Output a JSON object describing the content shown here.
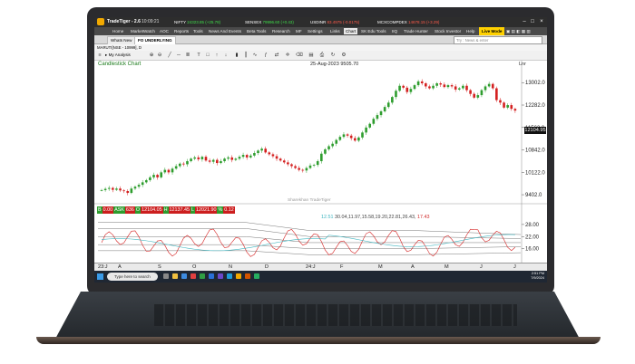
{
  "app": {
    "name": "TradeTiger - 2.6",
    "time": "10:09:21"
  },
  "tickers": [
    {
      "name": "NIFTY",
      "value": "24323.85 (+25.78)",
      "dir": "up"
    },
    {
      "name": "SENSEX",
      "value": "79996.60 (+0.43)",
      "dir": "up"
    },
    {
      "name": "USDINR",
      "value": "83.4975 (-0.0175)",
      "dir": "dn"
    },
    {
      "name": "MCXCOMPDEX",
      "value": "14678.15 (+3.29)",
      "dir": "dn"
    }
  ],
  "menu": [
    "Home",
    "MarketWatch",
    "AOC",
    "Reports",
    "Tools",
    "News And Events",
    "Beta Tools",
    "Research",
    "MF",
    "Settings",
    "Links",
    "Chart",
    "SK Edu Tools",
    "IIQ",
    "Trade Hunter",
    "Stock Investor",
    "Help"
  ],
  "menu_active": "Chart",
  "live_mode": "Live Mode",
  "tabs": [
    "Whats New",
    "FO UNDERLYING"
  ],
  "search_placeholder": "Try : News & enter",
  "symbol": "MARUTI[NSE - 10999], D",
  "analysis_label": "My Analysis",
  "chart_title": "Candlestick Chart",
  "date_label": "25-Aug-2023 9505.70",
  "scale_label": "Lnr",
  "last_price": "12104.95",
  "ohlc": {
    "B": "0.00",
    "ASK": "636",
    "O": "12104.05",
    "H": "12137.45",
    "L": "12021.90",
    "%": "0.12"
  },
  "indicator": {
    "v1": "12.51",
    "v2": "30.04,11.97,15.58,19.20,22.81,26.43,",
    "v3": "17.43"
  },
  "watermark": "Sharekhan  TradeTiger",
  "taskbar": {
    "search": "Type here to search",
    "time": "2:51 PM",
    "date": "7/9/2024"
  },
  "chart_data": {
    "type": "candlestick",
    "y_ticks": [
      13002,
      12282,
      11562,
      10842,
      10122,
      9402
    ],
    "ylim": [
      9200,
      13300
    ],
    "x_labels": [
      "23:J",
      "A",
      "S",
      "O",
      "N",
      "D",
      "24:J",
      "F",
      "M",
      "A",
      "M",
      "J",
      "J"
    ],
    "close": [
      9550,
      9590,
      9620,
      9560,
      9600,
      9540,
      9520,
      9460,
      9600,
      9660,
      9720,
      9800,
      9870,
      9960,
      10040,
      9960,
      10120,
      10200,
      10120,
      10240,
      10320,
      10400,
      10380,
      10480,
      10560,
      10600,
      10540,
      10620,
      10500,
      10460,
      10520,
      10420,
      10480,
      10560,
      10600,
      10520,
      10560,
      10620,
      10680,
      10600,
      10660,
      10740,
      10820,
      10880,
      10760,
      10700,
      10640,
      10560,
      10500,
      10440,
      10380,
      10320,
      10260,
      10200,
      10180,
      10260,
      10340,
      10360,
      10480,
      10720,
      10860,
      10960,
      11040,
      11160,
      11260,
      11340,
      11300,
      11220,
      11140,
      11240,
      11400,
      11560,
      11680,
      11840,
      11960,
      12080,
      12220,
      12360,
      12540,
      12740,
      12900,
      12840,
      12700,
      12800,
      12920,
      13040,
      12980,
      12880,
      12820,
      12900,
      12980,
      12940,
      12860,
      12920,
      12880,
      12780,
      12820,
      12900,
      12760,
      12640,
      12520,
      12600,
      12760,
      12880,
      12960,
      12820,
      12440,
      12360,
      12200,
      12280,
      12160,
      12104
    ],
    "indicator_ticks": [
      28.0,
      22.0,
      16.0
    ],
    "indicator_ylim": [
      10,
      32
    ]
  }
}
